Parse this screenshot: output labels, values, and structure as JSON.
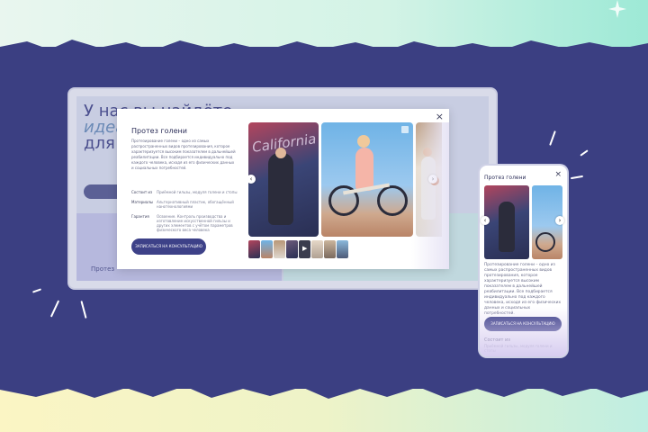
{
  "desktop_bg": {
    "headline_line1": "У нас вы найдёте",
    "headline_em": "идеал",
    "headline_line3": "для в",
    "card_label": "Протез"
  },
  "modal": {
    "title": "Протез голени",
    "description": "Протезирование голени – одно из самых распространенных видов протезирования, которое характеризуется высоким показателем в дальнейшей реабилитации. Все подбирается индивидуально под каждого человека, исходя из его физических данных и социальных потребностей.",
    "properties": [
      {
        "key": "Состоит из",
        "value": "Приёмной гильзы, модуля голени и стопы"
      },
      {
        "key": "Материалы",
        "value": "Альтернативный пластик, обогащённый нанотехнологиями"
      },
      {
        "key": "Гарантия",
        "value": "Освоение. Контроль производства и изготовление искусственной гильзы и других элементов с учётом параметров физического веса человека"
      }
    ],
    "cta": "ЗАПИСАТЬСЯ НА КОНСУЛЬТАЦИЮ",
    "close": "×",
    "prev": "‹",
    "next": "›",
    "graffiti_text": "California",
    "play": "▶"
  },
  "phone": {
    "title": "Протез голени",
    "close": "×",
    "description": "Протезирование голени – одно из самых распространенных видов протезирования, которое характеризуется высоким показателем в дальнейшей реабилитации. Все подбирается индивидуально под каждого человека, исходя из его физических данных и социальных потребностей.",
    "cta": "ЗАПИСАТЬСЯ НА КОНСУЛЬТАЦИЮ",
    "sub_title": "Состоит из",
    "sub_value": "Приёмной гильзы, модуля голени и стопы"
  },
  "colors": {
    "background": "#3b3f82",
    "accent": "#3d4188",
    "text_dark": "#2d2f59"
  }
}
